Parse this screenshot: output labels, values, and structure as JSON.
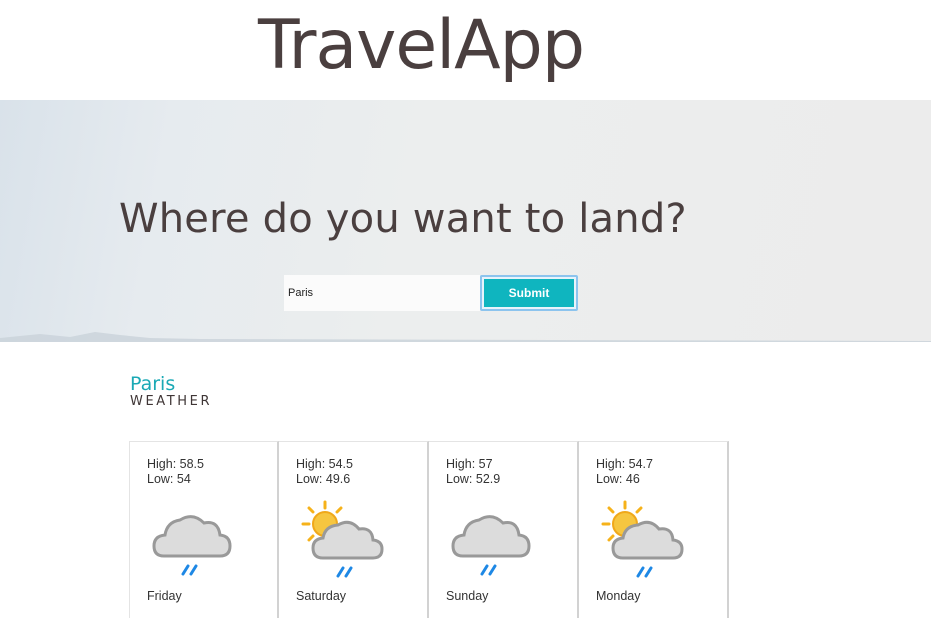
{
  "app": {
    "title": "TravelApp"
  },
  "hero": {
    "question": "Where do you want to land?",
    "search": {
      "value": "Paris",
      "placeholder": ""
    },
    "submit_label": "Submit"
  },
  "weather": {
    "city": "Paris",
    "label": "WEATHER",
    "days": [
      {
        "high": "High: 58.5",
        "low": "Low: 54",
        "day": "Friday",
        "icon": "rain-cloud-icon"
      },
      {
        "high": "High: 54.5",
        "low": "Low: 49.6",
        "day": "Saturday",
        "icon": "sun-cloud-rain-icon"
      },
      {
        "high": "High: 57",
        "low": "Low: 52.9",
        "day": "Sunday",
        "icon": "rain-cloud-icon"
      },
      {
        "high": "High: 54.7",
        "low": "Low: 46",
        "day": "Monday",
        "icon": "sun-cloud-rain-icon"
      }
    ]
  },
  "colors": {
    "accent": "#0fb5bf",
    "city": "#1aa9b5",
    "text": "#4a3f3f",
    "sun": "#f6b21a",
    "rain": "#1e88e5",
    "cloud": "#dcdcdc"
  }
}
